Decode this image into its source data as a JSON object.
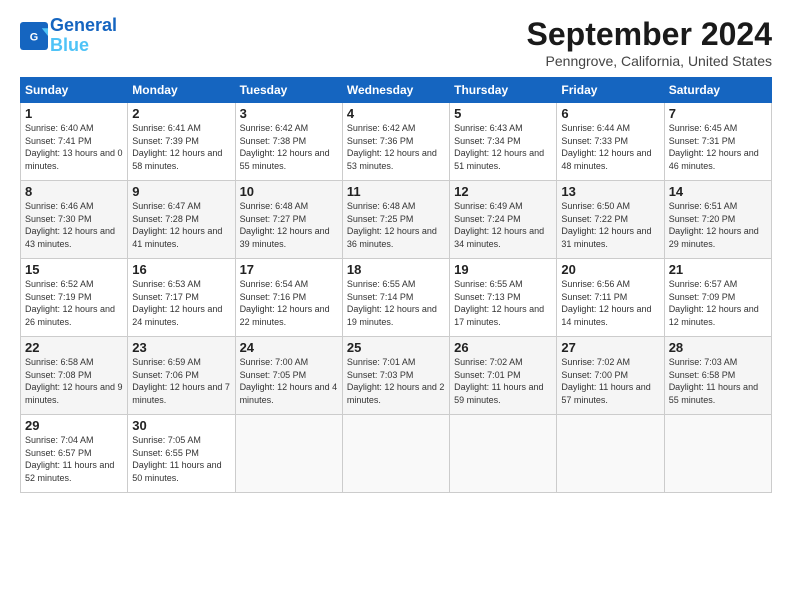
{
  "header": {
    "logo_line1": "General",
    "logo_line2": "Blue",
    "title": "September 2024",
    "subtitle": "Penngrove, California, United States"
  },
  "columns": [
    "Sunday",
    "Monday",
    "Tuesday",
    "Wednesday",
    "Thursday",
    "Friday",
    "Saturday"
  ],
  "weeks": [
    [
      {
        "day": "1",
        "sunrise": "Sunrise: 6:40 AM",
        "sunset": "Sunset: 7:41 PM",
        "daylight": "Daylight: 13 hours and 0 minutes."
      },
      {
        "day": "2",
        "sunrise": "Sunrise: 6:41 AM",
        "sunset": "Sunset: 7:39 PM",
        "daylight": "Daylight: 12 hours and 58 minutes."
      },
      {
        "day": "3",
        "sunrise": "Sunrise: 6:42 AM",
        "sunset": "Sunset: 7:38 PM",
        "daylight": "Daylight: 12 hours and 55 minutes."
      },
      {
        "day": "4",
        "sunrise": "Sunrise: 6:42 AM",
        "sunset": "Sunset: 7:36 PM",
        "daylight": "Daylight: 12 hours and 53 minutes."
      },
      {
        "day": "5",
        "sunrise": "Sunrise: 6:43 AM",
        "sunset": "Sunset: 7:34 PM",
        "daylight": "Daylight: 12 hours and 51 minutes."
      },
      {
        "day": "6",
        "sunrise": "Sunrise: 6:44 AM",
        "sunset": "Sunset: 7:33 PM",
        "daylight": "Daylight: 12 hours and 48 minutes."
      },
      {
        "day": "7",
        "sunrise": "Sunrise: 6:45 AM",
        "sunset": "Sunset: 7:31 PM",
        "daylight": "Daylight: 12 hours and 46 minutes."
      }
    ],
    [
      {
        "day": "8",
        "sunrise": "Sunrise: 6:46 AM",
        "sunset": "Sunset: 7:30 PM",
        "daylight": "Daylight: 12 hours and 43 minutes."
      },
      {
        "day": "9",
        "sunrise": "Sunrise: 6:47 AM",
        "sunset": "Sunset: 7:28 PM",
        "daylight": "Daylight: 12 hours and 41 minutes."
      },
      {
        "day": "10",
        "sunrise": "Sunrise: 6:48 AM",
        "sunset": "Sunset: 7:27 PM",
        "daylight": "Daylight: 12 hours and 39 minutes."
      },
      {
        "day": "11",
        "sunrise": "Sunrise: 6:48 AM",
        "sunset": "Sunset: 7:25 PM",
        "daylight": "Daylight: 12 hours and 36 minutes."
      },
      {
        "day": "12",
        "sunrise": "Sunrise: 6:49 AM",
        "sunset": "Sunset: 7:24 PM",
        "daylight": "Daylight: 12 hours and 34 minutes."
      },
      {
        "day": "13",
        "sunrise": "Sunrise: 6:50 AM",
        "sunset": "Sunset: 7:22 PM",
        "daylight": "Daylight: 12 hours and 31 minutes."
      },
      {
        "day": "14",
        "sunrise": "Sunrise: 6:51 AM",
        "sunset": "Sunset: 7:20 PM",
        "daylight": "Daylight: 12 hours and 29 minutes."
      }
    ],
    [
      {
        "day": "15",
        "sunrise": "Sunrise: 6:52 AM",
        "sunset": "Sunset: 7:19 PM",
        "daylight": "Daylight: 12 hours and 26 minutes."
      },
      {
        "day": "16",
        "sunrise": "Sunrise: 6:53 AM",
        "sunset": "Sunset: 7:17 PM",
        "daylight": "Daylight: 12 hours and 24 minutes."
      },
      {
        "day": "17",
        "sunrise": "Sunrise: 6:54 AM",
        "sunset": "Sunset: 7:16 PM",
        "daylight": "Daylight: 12 hours and 22 minutes."
      },
      {
        "day": "18",
        "sunrise": "Sunrise: 6:55 AM",
        "sunset": "Sunset: 7:14 PM",
        "daylight": "Daylight: 12 hours and 19 minutes."
      },
      {
        "day": "19",
        "sunrise": "Sunrise: 6:55 AM",
        "sunset": "Sunset: 7:13 PM",
        "daylight": "Daylight: 12 hours and 17 minutes."
      },
      {
        "day": "20",
        "sunrise": "Sunrise: 6:56 AM",
        "sunset": "Sunset: 7:11 PM",
        "daylight": "Daylight: 12 hours and 14 minutes."
      },
      {
        "day": "21",
        "sunrise": "Sunrise: 6:57 AM",
        "sunset": "Sunset: 7:09 PM",
        "daylight": "Daylight: 12 hours and 12 minutes."
      }
    ],
    [
      {
        "day": "22",
        "sunrise": "Sunrise: 6:58 AM",
        "sunset": "Sunset: 7:08 PM",
        "daylight": "Daylight: 12 hours and 9 minutes."
      },
      {
        "day": "23",
        "sunrise": "Sunrise: 6:59 AM",
        "sunset": "Sunset: 7:06 PM",
        "daylight": "Daylight: 12 hours and 7 minutes."
      },
      {
        "day": "24",
        "sunrise": "Sunrise: 7:00 AM",
        "sunset": "Sunset: 7:05 PM",
        "daylight": "Daylight: 12 hours and 4 minutes."
      },
      {
        "day": "25",
        "sunrise": "Sunrise: 7:01 AM",
        "sunset": "Sunset: 7:03 PM",
        "daylight": "Daylight: 12 hours and 2 minutes."
      },
      {
        "day": "26",
        "sunrise": "Sunrise: 7:02 AM",
        "sunset": "Sunset: 7:01 PM",
        "daylight": "Daylight: 11 hours and 59 minutes."
      },
      {
        "day": "27",
        "sunrise": "Sunrise: 7:02 AM",
        "sunset": "Sunset: 7:00 PM",
        "daylight": "Daylight: 11 hours and 57 minutes."
      },
      {
        "day": "28",
        "sunrise": "Sunrise: 7:03 AM",
        "sunset": "Sunset: 6:58 PM",
        "daylight": "Daylight: 11 hours and 55 minutes."
      }
    ],
    [
      {
        "day": "29",
        "sunrise": "Sunrise: 7:04 AM",
        "sunset": "Sunset: 6:57 PM",
        "daylight": "Daylight: 11 hours and 52 minutes."
      },
      {
        "day": "30",
        "sunrise": "Sunrise: 7:05 AM",
        "sunset": "Sunset: 6:55 PM",
        "daylight": "Daylight: 11 hours and 50 minutes."
      },
      null,
      null,
      null,
      null,
      null
    ]
  ]
}
